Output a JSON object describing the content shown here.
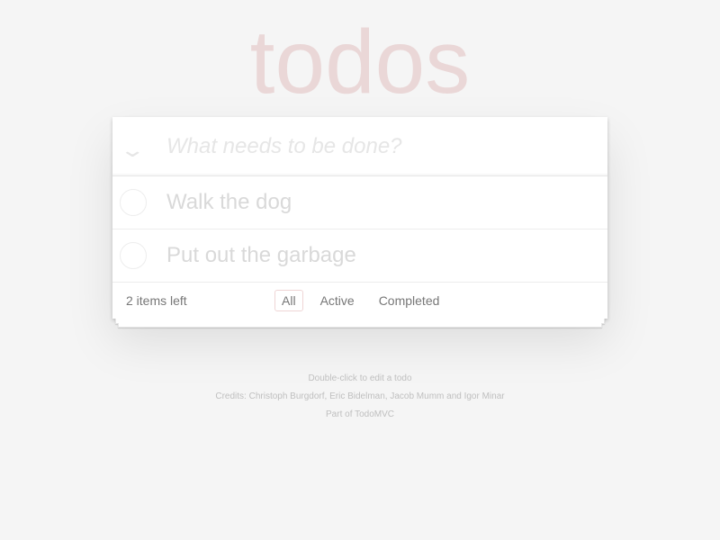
{
  "app": {
    "title": "todos"
  },
  "new_todo": {
    "placeholder": "What needs to be done?",
    "toggle_all_glyph": "❯"
  },
  "todos": [
    {
      "label": "Walk the dog",
      "completed": false
    },
    {
      "label": "Put out the garbage",
      "completed": false
    }
  ],
  "footer": {
    "items_left": "2 items left",
    "filters": [
      {
        "label": "All",
        "selected": true
      },
      {
        "label": "Active",
        "selected": false
      },
      {
        "label": "Completed",
        "selected": false
      }
    ]
  },
  "info": {
    "hint": "Double-click to edit a todo",
    "credits": "Credits: Christoph Burgdorf, Eric Bidelman, Jacob Mumm and Igor Minar",
    "part_of": "Part of TodoMVC"
  },
  "colors": {
    "background": "#f5f5f5",
    "title": "rgba(175,47,47,0.15)",
    "selected_filter_border": "rgba(175,47,47,0.2)"
  }
}
